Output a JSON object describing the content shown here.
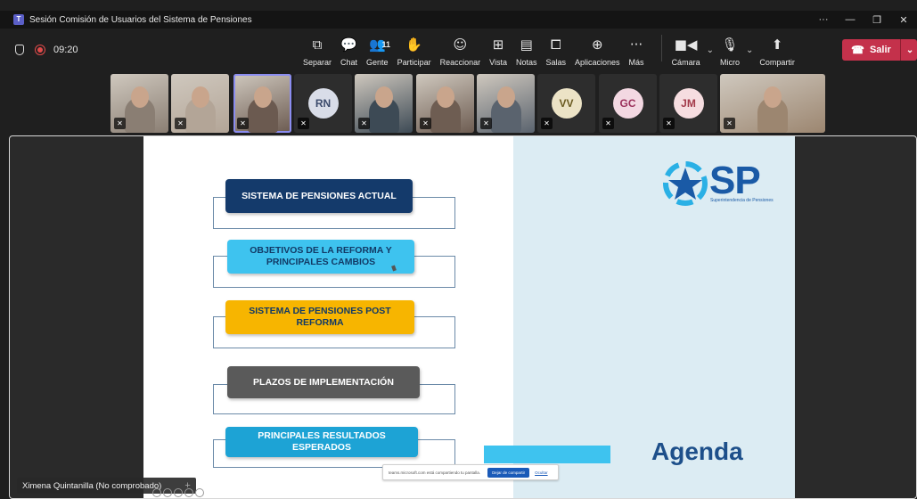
{
  "window": {
    "title": "Sesión Comisión de Usuarios del Sistema de Pensiones",
    "controls": {
      "more": "···",
      "minimize": "—",
      "restore": "❐",
      "close": "✕"
    }
  },
  "toolbar": {
    "timer": "09:20",
    "items": [
      {
        "label": "Separar",
        "icon": "pop-out-icon",
        "glyph": "⧉"
      },
      {
        "label": "Chat",
        "icon": "chat-icon",
        "glyph": "💬"
      },
      {
        "label": "Gente",
        "icon": "people-icon",
        "glyph": "👥",
        "badge": "11"
      },
      {
        "label": "Participar",
        "icon": "raise-hand-icon",
        "glyph": "✋"
      },
      {
        "label": "Reaccionar",
        "icon": "react-icon",
        "glyph": "☺"
      },
      {
        "label": "Vista",
        "icon": "view-icon",
        "glyph": "⊞"
      },
      {
        "label": "Notas",
        "icon": "notes-icon",
        "glyph": "▤"
      },
      {
        "label": "Salas",
        "icon": "rooms-icon",
        "glyph": "⧠"
      },
      {
        "label": "Aplicaciones",
        "icon": "apps-icon",
        "glyph": "⊕"
      },
      {
        "label": "Más",
        "icon": "more-icon",
        "glyph": "···"
      }
    ],
    "camera_label": "Cámara",
    "mic_label": "Micro",
    "share_label": "Compartir",
    "leave_label": "Salir",
    "accent_leave": "#c4314b"
  },
  "participants": [
    {
      "type": "video",
      "tone": "#8a7e73"
    },
    {
      "type": "video",
      "tone": "#b3a597"
    },
    {
      "type": "video",
      "tone": "#6b5a50",
      "active": true
    },
    {
      "type": "initials",
      "initials": "RN",
      "bg": "#d9dde8",
      "fg": "#3b4a6b"
    },
    {
      "type": "video",
      "tone": "#3d4a55"
    },
    {
      "type": "video",
      "tone": "#6e5d52"
    },
    {
      "type": "video",
      "tone": "#5a636e"
    },
    {
      "type": "initials",
      "initials": "VV",
      "bg": "#ece3c6",
      "fg": "#6a5a20"
    },
    {
      "type": "initials",
      "initials": "GC",
      "bg": "#f3d8e2",
      "fg": "#9a2f5a"
    },
    {
      "type": "initials",
      "initials": "JM",
      "bg": "#f6dde0",
      "fg": "#a33a4a"
    },
    {
      "type": "video",
      "tone": "#9c8670"
    }
  ],
  "slide": {
    "items": [
      {
        "text": "SISTEMA DE PENSIONES ACTUAL",
        "bg": "#143a6b",
        "fg": "#ffffff"
      },
      {
        "text": "OBJETIVOS DE LA REFORMA Y PRINCIPALES CAMBIOS",
        "bg": "#3ec3ef",
        "fg": "#123a66"
      },
      {
        "text": "SISTEMA DE PENSIONES POST REFORMA",
        "bg": "#f7b500",
        "fg": "#123a66"
      },
      {
        "text": "PLAZOS DE IMPLEMENTACIÓN",
        "bg": "#5a5a5a",
        "fg": "#ffffff"
      },
      {
        "text": "PRINCIPALES RESULTADOS ESPERADOS",
        "bg": "#1da3d5",
        "fg": "#ffffff"
      }
    ],
    "logo_text": "SP",
    "logo_subtitle": "Superintendencia de Pensiones",
    "agenda_title": "Agenda",
    "share_notice": "teams.microsoft.com está compartiendo tu pantalla.",
    "share_stop": "Dejar de compartir",
    "share_hide": "Ocultar"
  },
  "presenter_name": "Ximena Quintanilla (No comprobado)"
}
